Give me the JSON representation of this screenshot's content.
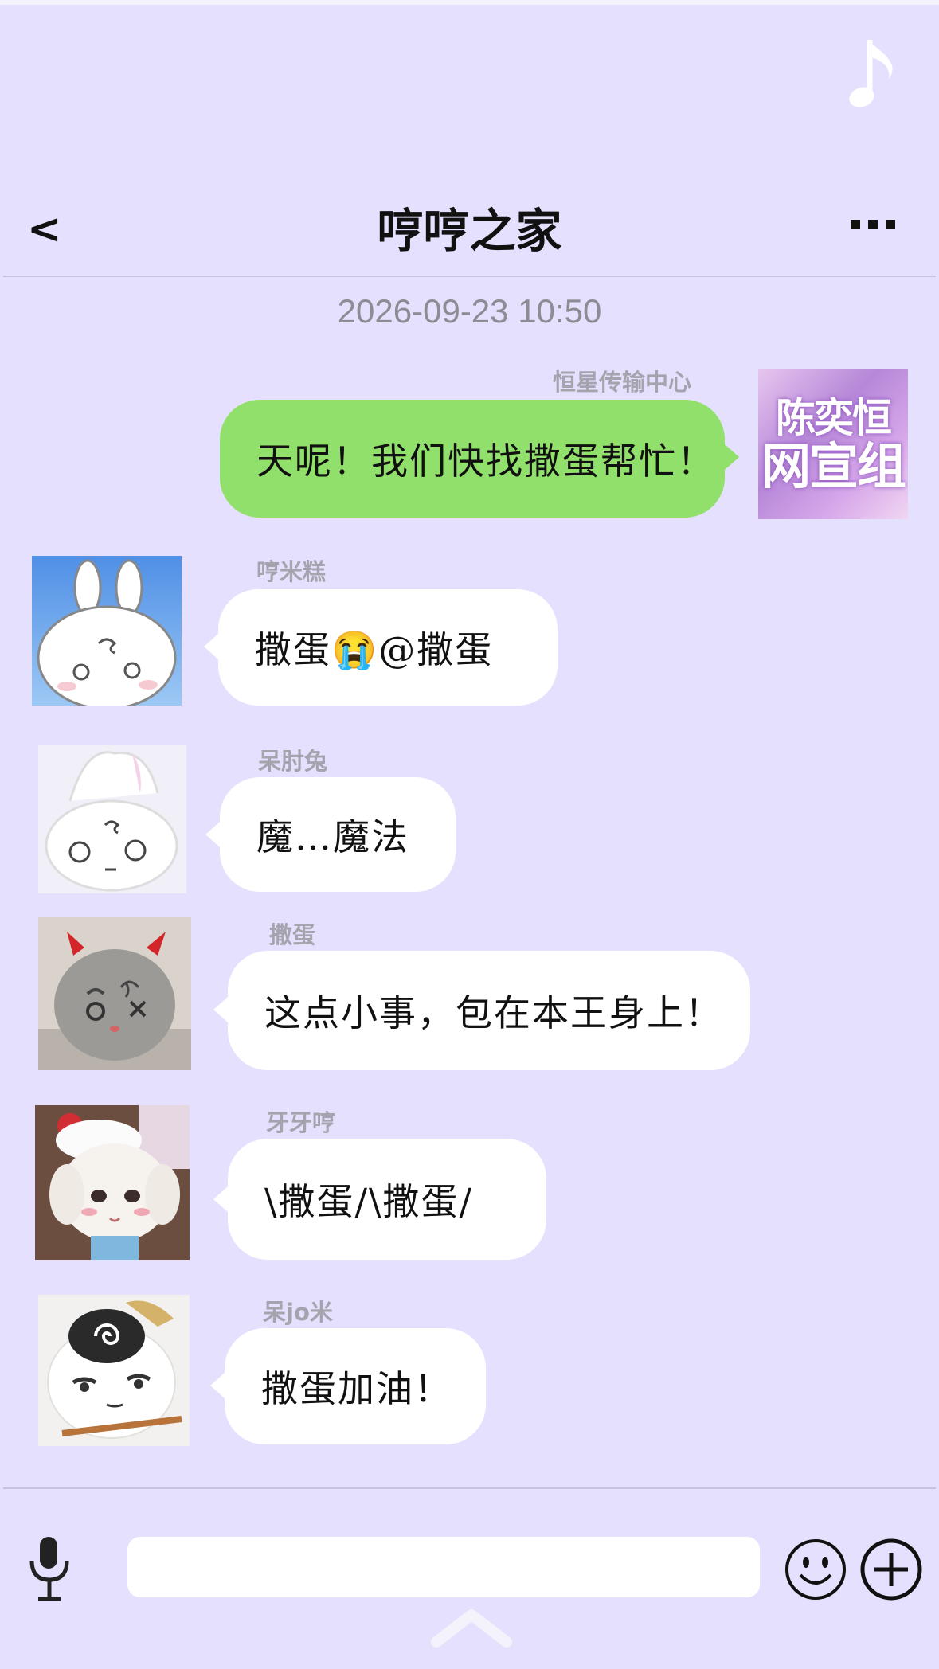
{
  "header": {
    "back_label": "<",
    "title": "哼哼之家",
    "more_label": "more"
  },
  "timestamp": "2026-09-23 10:50",
  "messages": [
    {
      "sender": "恒星传输中心",
      "text": "天呢！我们快找撒蛋帮忙！",
      "side": "right",
      "avatar": "group-poster"
    },
    {
      "sender": "哼米糕",
      "text": "撒蛋😭@撒蛋",
      "side": "left",
      "avatar": "bunny"
    },
    {
      "sender": "呆肘兔",
      "text": "魔…魔法",
      "side": "left",
      "avatar": "chef-bunny"
    },
    {
      "sender": "撒蛋",
      "text": "这点小事，包在本王身上！",
      "side": "left",
      "avatar": "devil-plush"
    },
    {
      "sender": "牙牙哼",
      "text": "\\撒蛋/\\撒蛋/",
      "side": "left",
      "avatar": "puppy-plush"
    },
    {
      "sender": "呆jo米",
      "text": "撒蛋加油！",
      "side": "left",
      "avatar": "swirl-plush"
    }
  ],
  "group_avatar_text": {
    "line1": "陈奕恒",
    "line2": "网宣组"
  },
  "composer": {
    "placeholder": "",
    "value": ""
  },
  "icons": {
    "music": "music-note-icon",
    "mic": "microphone-icon",
    "emoji": "smiley-icon",
    "plus": "plus-circle-icon",
    "expand": "chevron-up-icon"
  },
  "colors": {
    "background": "#e5e0fd",
    "sent_bubble": "#92e06c",
    "received_bubble": "#ffffff",
    "name_gray": "#a5a3ae"
  }
}
